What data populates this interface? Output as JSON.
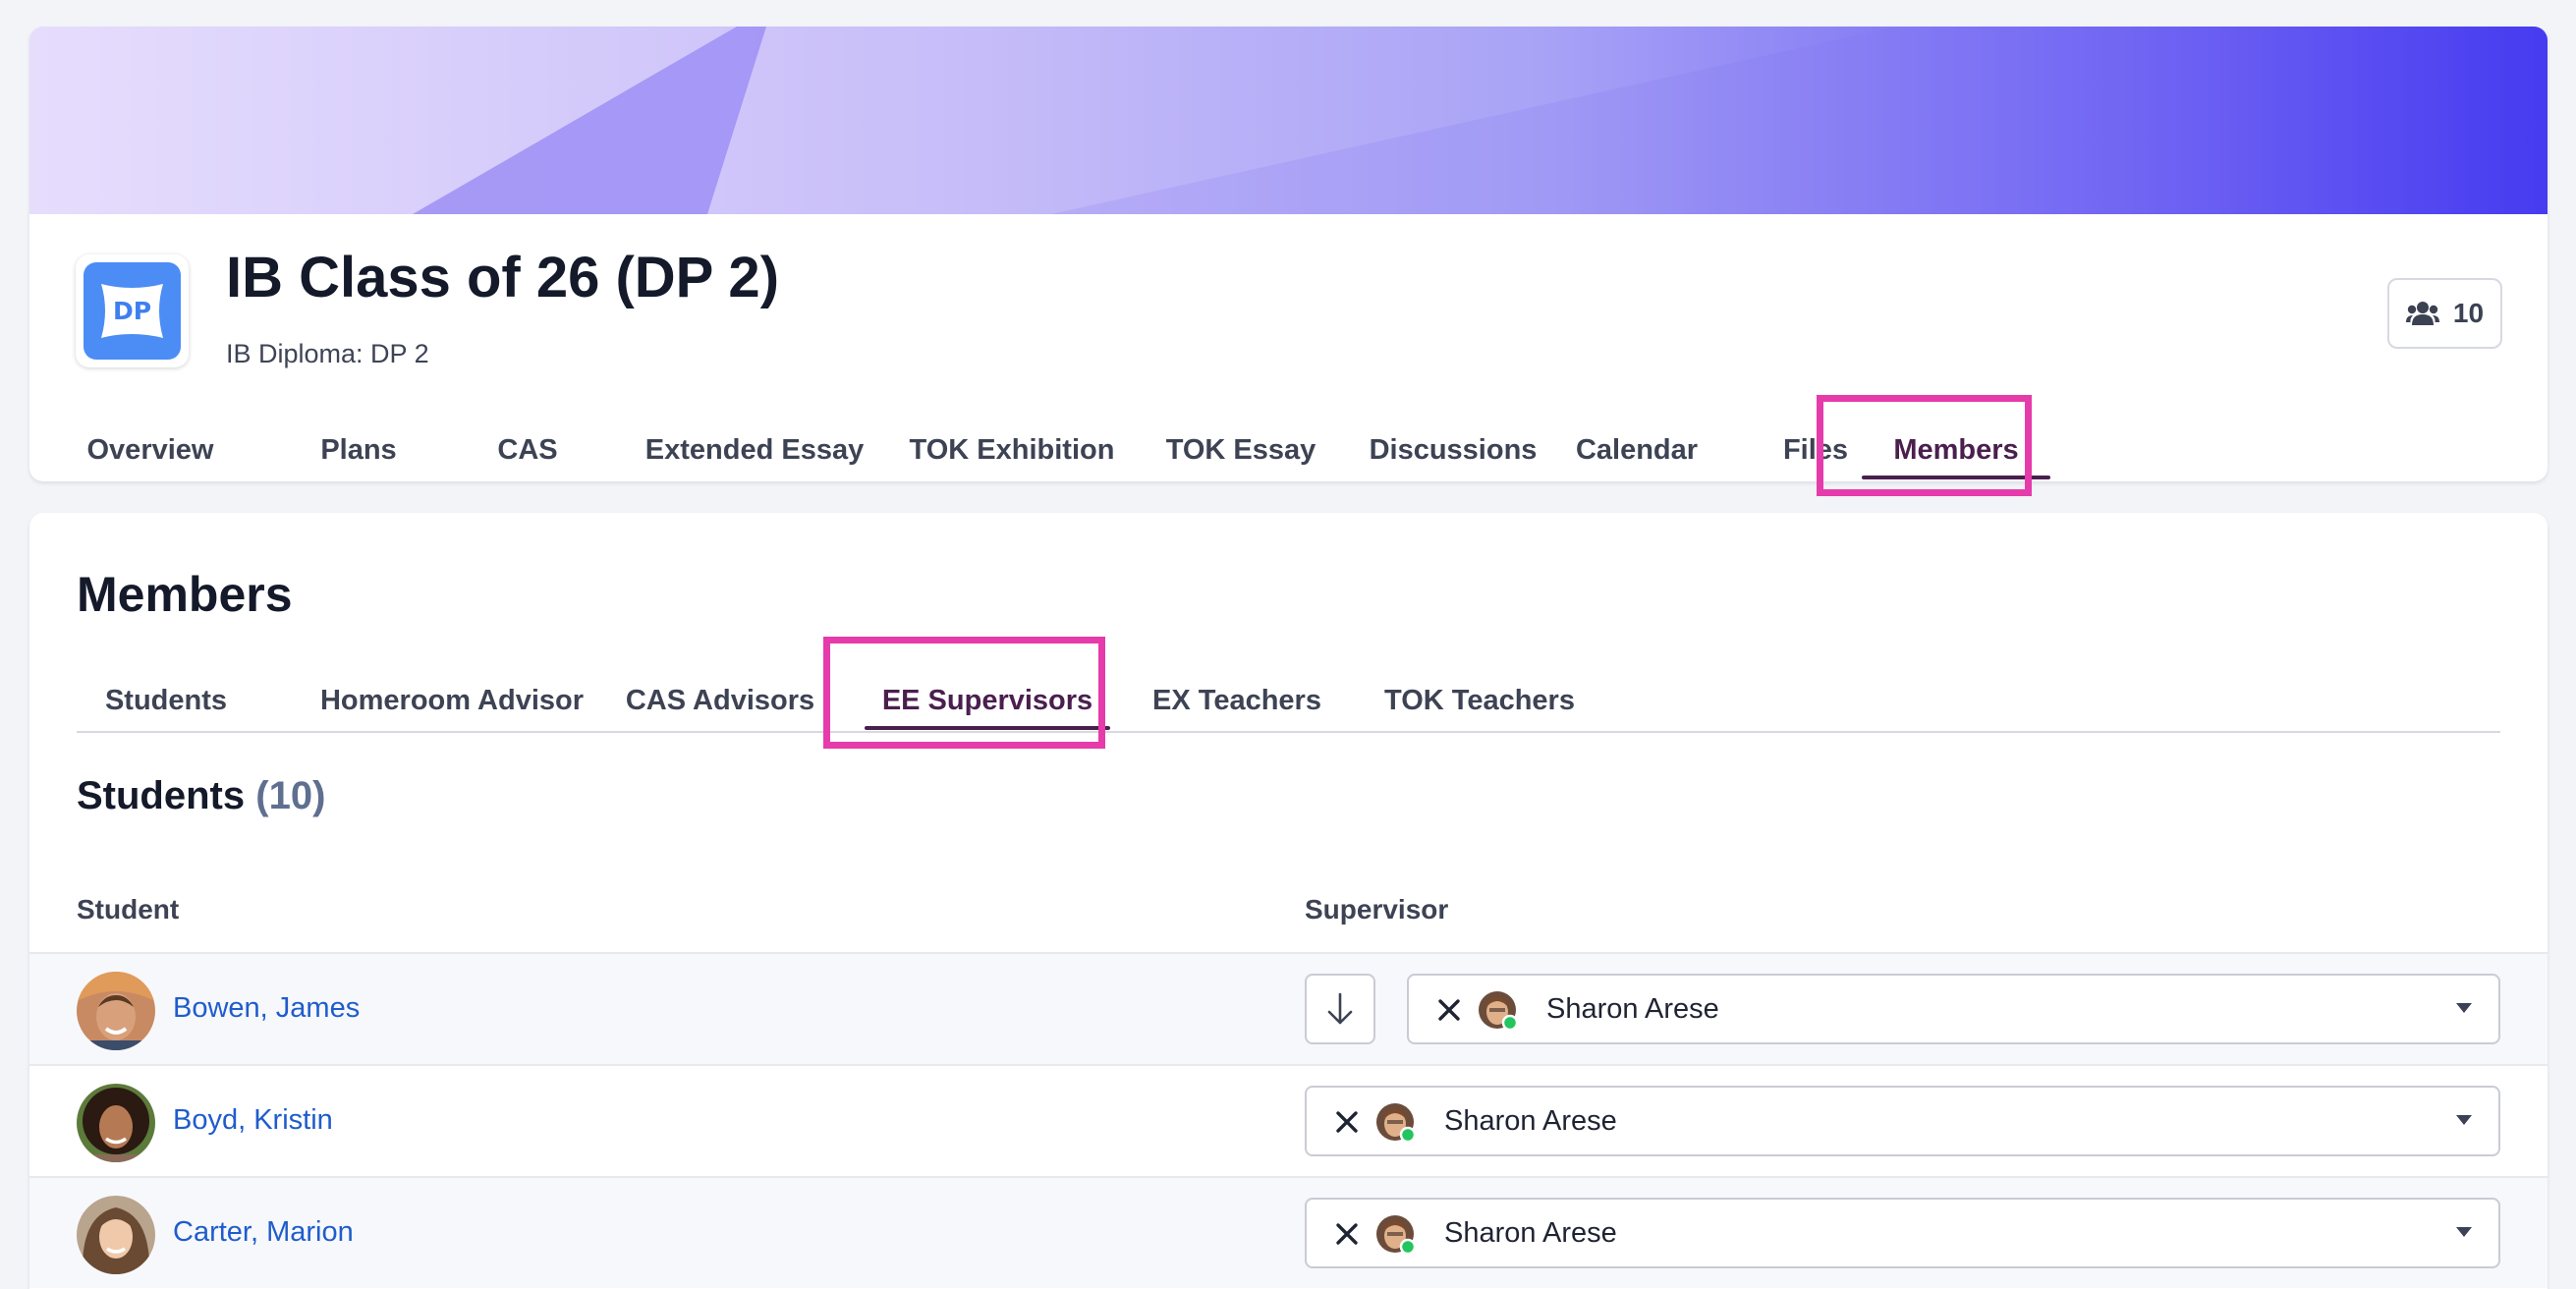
{
  "header": {
    "title": "IB Class of 26 (DP 2)",
    "subtitle": "IB Diploma: DP 2",
    "icon_text": "DP",
    "member_count": "10",
    "member_icon": "users-icon"
  },
  "main_tabs": [
    {
      "label": "Overview"
    },
    {
      "label": "Plans"
    },
    {
      "label": "CAS"
    },
    {
      "label": "Extended Essay"
    },
    {
      "label": "TOK Exhibition"
    },
    {
      "label": "TOK Essay"
    },
    {
      "label": "Discussions"
    },
    {
      "label": "Calendar"
    },
    {
      "label": "Files"
    },
    {
      "label": "Members",
      "active": true
    }
  ],
  "members": {
    "heading": "Members",
    "sub_tabs": [
      {
        "label": "Students"
      },
      {
        "label": "Homeroom Advisor"
      },
      {
        "label": "CAS Advisors"
      },
      {
        "label": "EE Supervisors",
        "active": true
      },
      {
        "label": "EX Teachers"
      },
      {
        "label": "TOK Teachers"
      }
    ],
    "students_heading": "Students",
    "students_count": "(10)",
    "columns": {
      "student": "Student",
      "supervisor": "Supervisor"
    },
    "rows": [
      {
        "student": "Bowen, James",
        "supervisor": "Sharon Arese",
        "has_fill_down": true
      },
      {
        "student": "Boyd, Kristin",
        "supervisor": "Sharon Arese",
        "has_fill_down": false
      },
      {
        "student": "Carter, Marion",
        "supervisor": "Sharon Arese",
        "has_fill_down": false
      }
    ]
  },
  "colors": {
    "accent_active": "#4a1f4e",
    "highlight": "#e63bab",
    "link": "#1f5ccc",
    "banner_end": "#3a2ff0",
    "online_dot": "#22c55e"
  }
}
